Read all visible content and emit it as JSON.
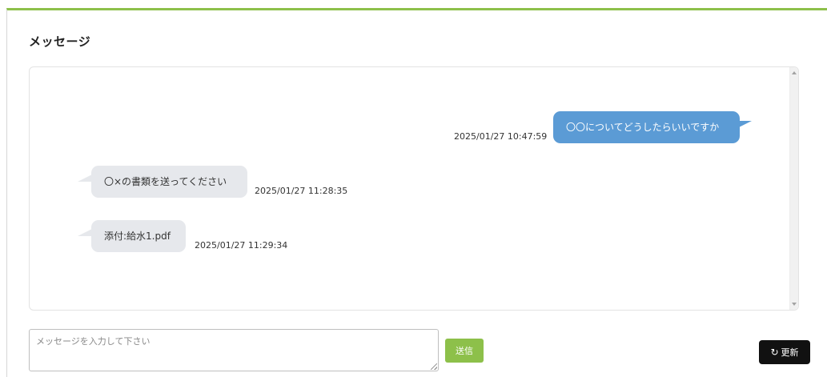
{
  "panel": {
    "title": "メッセージ"
  },
  "messages": [
    {
      "direction": "sent",
      "text": "〇〇についてどうしたらいいですか",
      "timestamp": "2025/01/27 10:47:59"
    },
    {
      "direction": "received",
      "text": "〇×の書類を送ってください",
      "timestamp": "2025/01/27 11:28:35"
    },
    {
      "direction": "received",
      "text": "添付:給水1.pdf",
      "timestamp": "2025/01/27 11:29:34"
    }
  ],
  "composer": {
    "placeholder": "メッセージを入力して下さい",
    "value": "",
    "send_label": "送信"
  },
  "refresh": {
    "label": "更新",
    "icon": "refresh-icon"
  },
  "colors": {
    "accent_green": "#8dc04a",
    "sent_bubble": "#5b9bd5",
    "received_bubble": "#e6e8ec",
    "refresh_button": "#111111"
  }
}
